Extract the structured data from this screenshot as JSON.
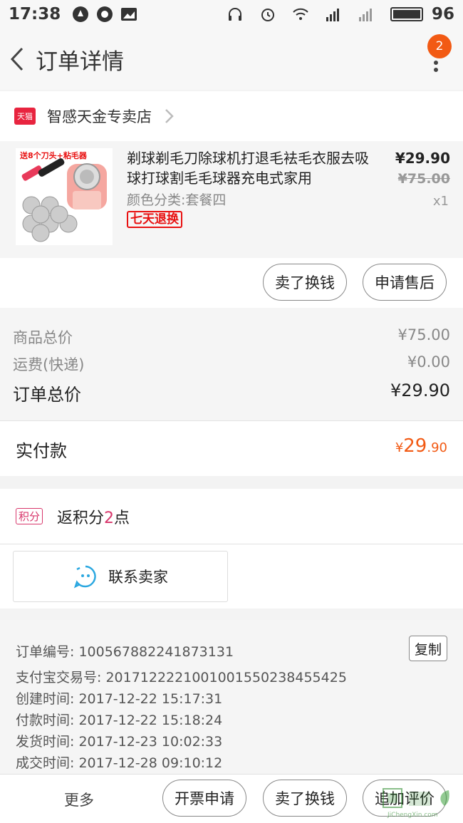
{
  "status_bar": {
    "time": "17:38",
    "battery": "96",
    "battery_level": 0.9
  },
  "nav": {
    "title": "订单详情",
    "badge": "2"
  },
  "shop": {
    "logo_text": "天猫",
    "name": "智感天金专卖店"
  },
  "product": {
    "thumb_banner": "送8个刀头+粘毛器",
    "title": "剃球剃毛刀除球机打退毛袪毛衣服去吸球打球割毛毛球器充电式家用",
    "sku": "颜色分类:套餐四",
    "tag": "七天退换",
    "price_now": "¥29.90",
    "price_old": "¥75.00",
    "qty": "x1"
  },
  "actions": {
    "sell_exchange": "卖了换钱",
    "after_sale": "申请售后"
  },
  "summary": {
    "goods_total_label": "商品总价",
    "goods_total_value": "¥75.00",
    "shipping_label": "运费(快递)",
    "shipping_value": "¥0.00",
    "order_total_label": "订单总价",
    "order_total_value": "¥29.90"
  },
  "paid": {
    "label": "实付款",
    "currency": "¥",
    "integer": "29",
    "decimal": ".90"
  },
  "points": {
    "tag": "积分",
    "prefix": "返积分",
    "number": "2",
    "suffix": "点"
  },
  "contact": {
    "label": "联系卖家"
  },
  "order_info": {
    "order_no": "订单编号: 100567882241873131",
    "alipay_no": "支付宝交易号: 2017122221001001550238455425",
    "created": "创建时间: 2017-12-22 15:17:31",
    "paid": "付款时间: 2017-12-22 15:18:24",
    "shipped": "发货时间: 2017-12-23 10:02:33",
    "completed": "成交时间: 2017-12-28 09:10:12",
    "copy_label": "复制"
  },
  "bottom_bar": {
    "more": "更多",
    "invoice": "开票申请",
    "sell_exchange": "卖了换钱",
    "review": "追加评价"
  },
  "watermark": {
    "sub": "JiChengXin.com"
  },
  "colors": {
    "accent": "#f25a14",
    "points": "#d8366b",
    "tmall": "#e8243f",
    "tag_red": "#e81010",
    "contact_icon": "#2aa7e0"
  }
}
